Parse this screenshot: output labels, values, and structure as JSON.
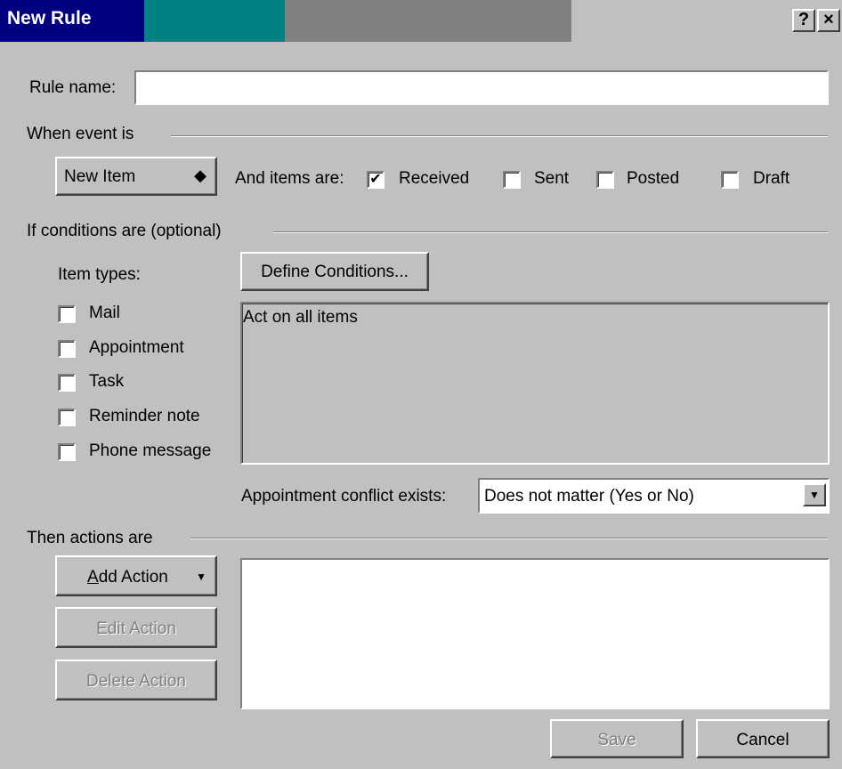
{
  "window": {
    "title": "New Rule",
    "help_glyph": "?",
    "close_glyph": "×"
  },
  "rule_name": {
    "label": "Rule name:",
    "value": ""
  },
  "event": {
    "group_label": "When event is",
    "event_select": "New Item",
    "event_select_arrow": "◆",
    "items_are_label": "And items are:",
    "checkboxes": [
      {
        "label": "Received",
        "checked": true
      },
      {
        "label": "Sent",
        "checked": false
      },
      {
        "label": "Posted",
        "checked": false
      },
      {
        "label": "Draft",
        "checked": false
      }
    ]
  },
  "conditions": {
    "group_label": "If conditions are  (optional)",
    "item_types_label": "Item types:",
    "item_types": [
      {
        "label": "Mail",
        "checked": false
      },
      {
        "label": "Appointment",
        "checked": false
      },
      {
        "label": "Task",
        "checked": false
      },
      {
        "label": "Reminder note",
        "checked": false
      },
      {
        "label": "Phone message",
        "checked": false
      }
    ],
    "define_button": "Define Conditions...",
    "conditions_text": "Act on all items",
    "conflict_label": "Appointment conflict exists:",
    "conflict_value": "Does not matter (Yes or No)",
    "conflict_arrow": "▼"
  },
  "actions": {
    "group_label": "Then actions are",
    "add_action_prefix": "A",
    "add_action_rest": "dd Action",
    "add_action_arrow": "▼",
    "edit_action": "Edit Action",
    "delete_action": "Delete Action"
  },
  "footer": {
    "save": "Save",
    "cancel": "Cancel"
  },
  "check_glyph": "✔"
}
